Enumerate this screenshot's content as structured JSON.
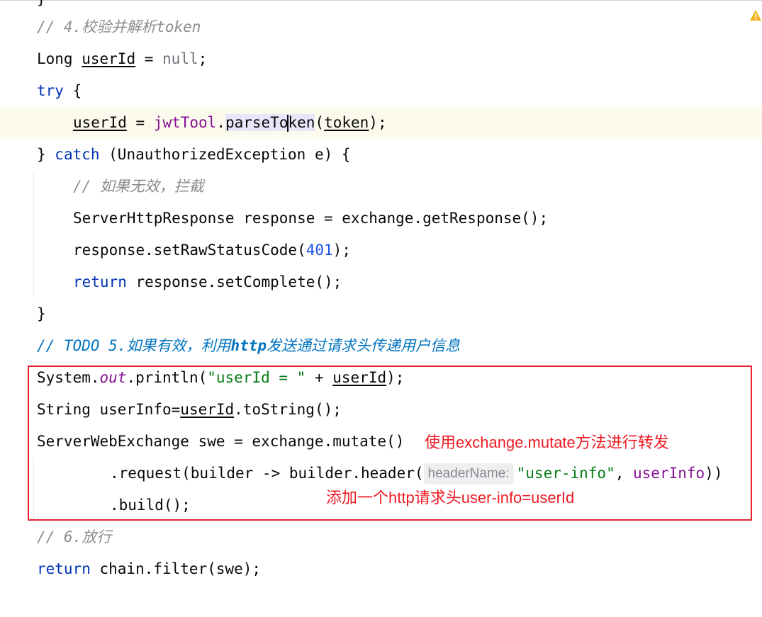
{
  "colors": {
    "keyword": "#0033b3",
    "comment": "#8c8c8c",
    "todo": "#0073bf",
    "string": "#067d17",
    "number": "#1750eb",
    "field": "#871094",
    "annotation": "#ee1c25",
    "highlight_box": "#e4202d"
  },
  "icons": {
    "warning": "warning-triangle-icon"
  },
  "lines": {
    "l1": {
      "comment": "// 4.校验并解析token"
    },
    "l2": {
      "type": "Long",
      "var": "userId",
      "op": " = ",
      "null": "null",
      "end": ";"
    },
    "l3": {
      "kw": "try",
      "rest": " {"
    },
    "l4": {
      "var": "userId",
      "op": " = ",
      "obj": "jwtTool",
      "dot": ".",
      "m1": "parseTo",
      "m2": "ken",
      "open": "(",
      "arg": "token",
      "close": ");"
    },
    "l5": {
      "brace": "} ",
      "kw": "catch",
      "rest": " (UnauthorizedException e) {"
    },
    "l6": {
      "comment": "// 如果无效，拦截"
    },
    "l7": {
      "text": "ServerHttpResponse response = exchange.getResponse();"
    },
    "l8": {
      "pre": "response.setRawStatusCode(",
      "num": "401",
      "post": ");"
    },
    "l9": {
      "kw": "return",
      "rest": " response.setComplete();"
    },
    "l10": {
      "text": "}"
    },
    "l11": {
      "prefix": "// TODO 5.",
      "cn1": "如果有效，利用",
      "http": "http",
      "cn2": "发送通过请求头传递用户信息"
    },
    "l12": {
      "a": "System.",
      "out": "out",
      "b": ".println(",
      "str": "\"userId = \"",
      "c": " + ",
      "var": "userId",
      "d": ");"
    },
    "l13": {
      "a": "String userInfo=",
      "var": "userId",
      "b": ".toString();"
    },
    "l14": {
      "text": "ServerWebExchange swe = exchange.mutate()"
    },
    "l15": {
      "a": ".request(builder -> builder.header(",
      "hint": "headerName:",
      "str": "\"user-info\"",
      "b": ", ",
      "var": "userInfo",
      "c": "))"
    },
    "l16": {
      "text": ".build();"
    },
    "l17": {
      "comment": "// 6.放行"
    },
    "l18": {
      "kw": "return",
      "rest": " chain.filter(swe);"
    }
  },
  "annotations": {
    "mutate_note": "使用exchange.mutate方法进行转发",
    "header_note": "添加一个http请求头user-info=userId"
  }
}
